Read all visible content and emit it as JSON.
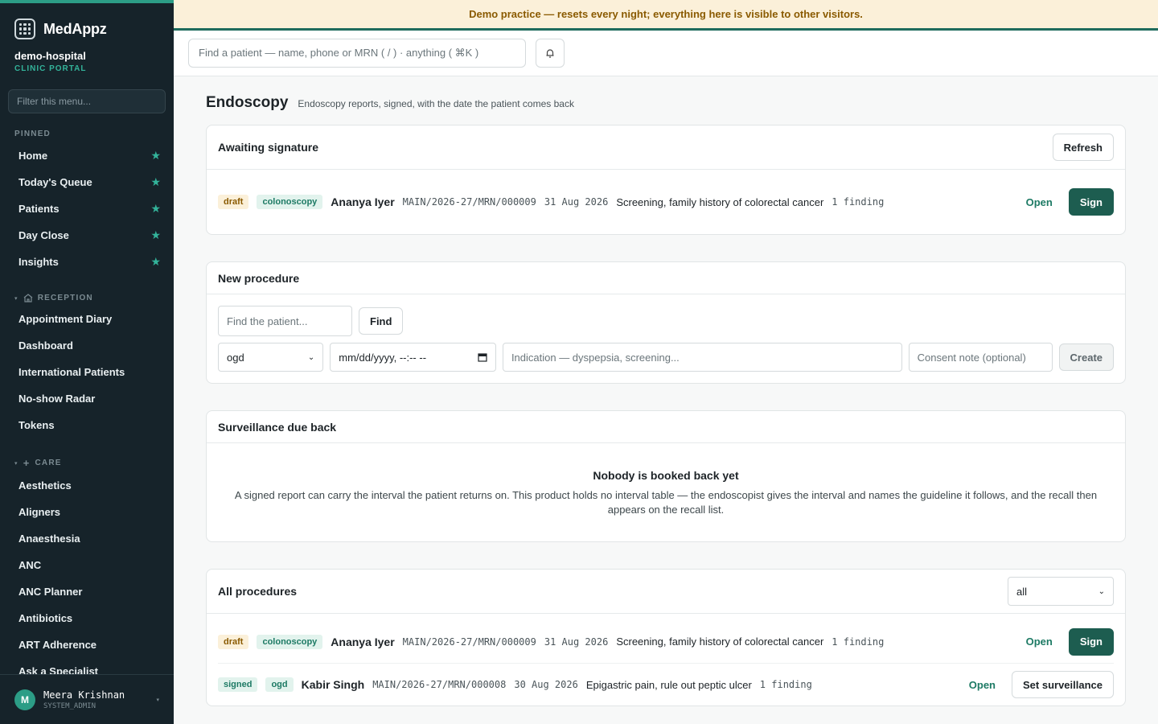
{
  "brand": {
    "name": "MedAppz"
  },
  "org": {
    "name": "demo-hospital",
    "subtitle": "CLINIC PORTAL"
  },
  "sidebar": {
    "filter_placeholder": "Filter this menu...",
    "pinned_label": "PINNED",
    "pinned": [
      {
        "label": "Home"
      },
      {
        "label": "Today's Queue"
      },
      {
        "label": "Patients"
      },
      {
        "label": "Day Close"
      },
      {
        "label": "Insights"
      }
    ],
    "reception_label": "RECEPTION",
    "reception": [
      {
        "label": "Appointment Diary"
      },
      {
        "label": "Dashboard"
      },
      {
        "label": "International Patients"
      },
      {
        "label": "No-show Radar"
      },
      {
        "label": "Tokens"
      }
    ],
    "care_label": "CARE",
    "care": [
      {
        "label": "Aesthetics"
      },
      {
        "label": "Aligners"
      },
      {
        "label": "Anaesthesia"
      },
      {
        "label": "ANC"
      },
      {
        "label": "ANC Planner"
      },
      {
        "label": "Antibiotics"
      },
      {
        "label": "ART Adherence"
      },
      {
        "label": "Ask a Specialist"
      }
    ]
  },
  "user": {
    "initial": "M",
    "name": "Meera Krishnan",
    "role": "SYSTEM_ADMIN"
  },
  "banner": {
    "text": "Demo practice — resets every night; everything here is visible to other visitors."
  },
  "topbar": {
    "search_placeholder": "Find a patient — name, phone or MRN ( / ) · anything ( ⌘K )"
  },
  "page": {
    "title": "Endoscopy",
    "subtitle": "Endoscopy reports, signed, with the date the patient comes back"
  },
  "awaiting": {
    "title": "Awaiting signature",
    "refresh_label": "Refresh",
    "rows": [
      {
        "status": "draft",
        "type": "colonoscopy",
        "patient": "Ananya Iyer",
        "mrn": "MAIN/2026-27/MRN/000009",
        "date": "31 Aug 2026",
        "indication": "Screening, family history of colorectal cancer",
        "findings": "1 finding",
        "open_label": "Open",
        "action_label": "Sign"
      }
    ]
  },
  "new_procedure": {
    "title": "New procedure",
    "patient_placeholder": "Find the patient...",
    "find_label": "Find",
    "type_value": "ogd",
    "datetime_placeholder": "mm/dd/yyyy, --:-- --",
    "indication_placeholder": "Indication — dyspepsia, screening...",
    "consent_placeholder": "Consent note (optional)",
    "create_label": "Create"
  },
  "surveillance": {
    "title": "Surveillance due back",
    "empty_title": "Nobody is booked back yet",
    "empty_text": "A signed report can carry the interval the patient returns on. This product holds no interval table — the endoscopist gives the interval and names the guideline it follows, and the recall then appears on the recall list."
  },
  "all_procedures": {
    "title": "All procedures",
    "filter_value": "all",
    "rows": [
      {
        "status": "draft",
        "type": "colonoscopy",
        "patient": "Ananya Iyer",
        "mrn": "MAIN/2026-27/MRN/000009",
        "date": "31 Aug 2026",
        "indication": "Screening, family history of colorectal cancer",
        "findings": "1 finding",
        "open_label": "Open",
        "action_label": "Sign"
      },
      {
        "status": "signed",
        "type": "ogd",
        "patient": "Kabir Singh",
        "mrn": "MAIN/2026-27/MRN/000008",
        "date": "30 Aug 2026",
        "indication": "Epigastric pain, rule out peptic ulcer",
        "findings": "1 finding",
        "open_label": "Open",
        "action_label": "Set surveillance"
      }
    ]
  }
}
